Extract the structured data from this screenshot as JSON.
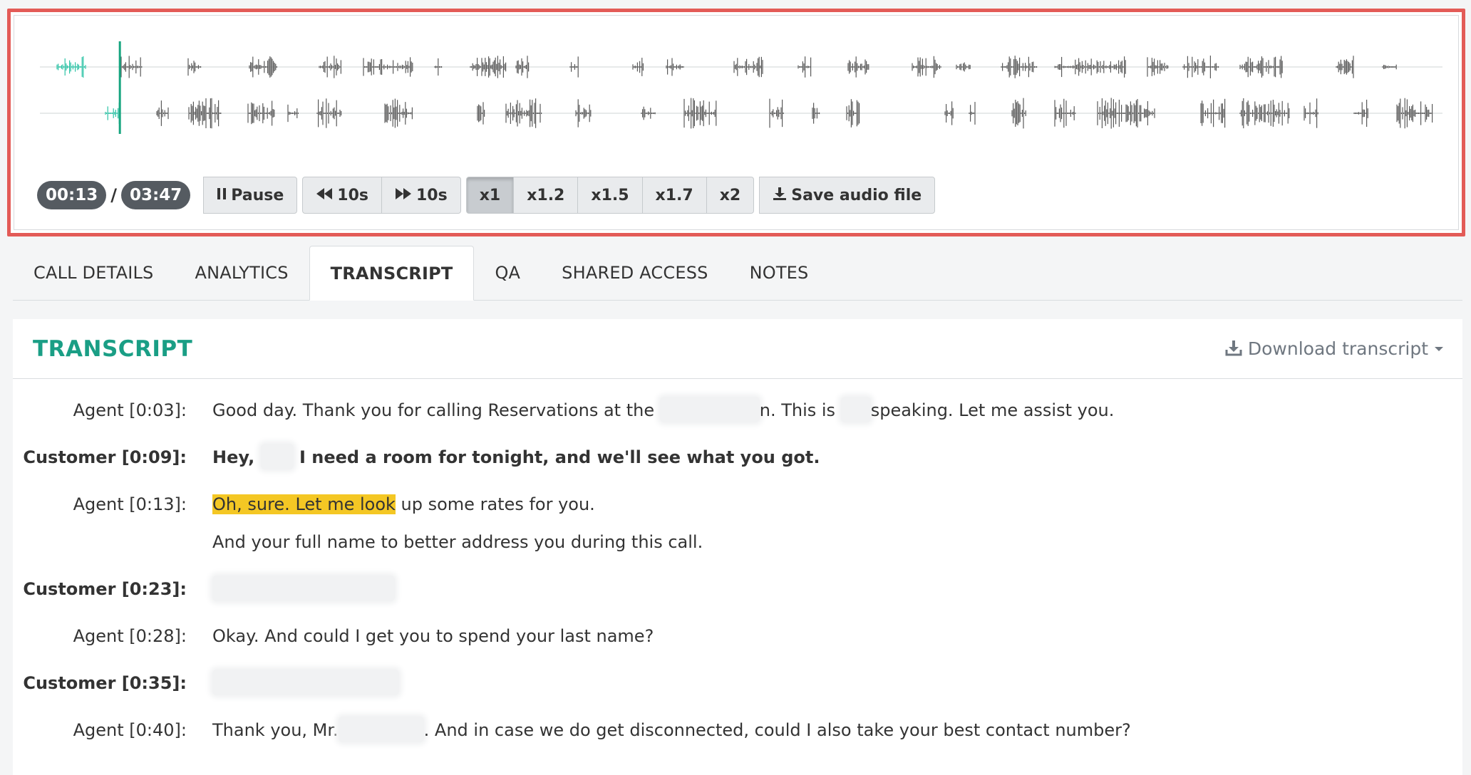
{
  "player": {
    "current_time": "00:13",
    "separator": "/",
    "total_time": "03:47",
    "progress_fraction": 0.057,
    "waveform_color": "#5a5a5a",
    "played_color": "#2bc3a5",
    "playhead_color": "#16a57f",
    "pause_label": "Pause",
    "pause_icon": "pause-icon",
    "rewind_label": "10s",
    "rewind_icon": "backward-icon",
    "forward_label": "10s",
    "forward_icon": "forward-icon",
    "speeds": [
      "x1",
      "x1.2",
      "x1.5",
      "x1.7",
      "x2"
    ],
    "active_speed": "x1",
    "save_label": "Save audio file",
    "save_icon": "download-icon"
  },
  "tabs": [
    {
      "label": "CALL DETAILS",
      "active": false
    },
    {
      "label": "ANALYTICS",
      "active": false
    },
    {
      "label": "TRANSCRIPT",
      "active": true
    },
    {
      "label": "QA",
      "active": false
    },
    {
      "label": "SHARED ACCESS",
      "active": false
    },
    {
      "label": "NOTES",
      "active": false
    }
  ],
  "transcript": {
    "title": "TRANSCRIPT",
    "download_label": "Download transcript",
    "highlight_color": "#f4c724",
    "rows": [
      {
        "speaker": "Agent [0:03]:",
        "parts": [
          "Good day. Thank you for calling Reservations at the ",
          "n. This is ",
          "speaking. Let me assist you."
        ]
      },
      {
        "speaker": "Customer [0:09]:",
        "parts": [
          "Hey, ",
          " I need a room for tonight, and we'll see what you got."
        ]
      },
      {
        "speaker": "Agent [0:13]:",
        "highlight": "Oh, sure. Let me look",
        "parts": [
          " up some rates for you."
        ],
        "line2": "And your full name to better address you during this call."
      },
      {
        "speaker": "Customer [0:23]:",
        "parts": []
      },
      {
        "speaker": "Agent [0:28]:",
        "parts": [
          "Okay. And could I get you to spend your last name?"
        ]
      },
      {
        "speaker": "Customer [0:35]:",
        "parts": []
      },
      {
        "speaker": "Agent [0:40]:",
        "parts": [
          "Thank you, Mr.",
          ". And in case we do get disconnected, could I also take your best contact number?"
        ]
      }
    ]
  }
}
